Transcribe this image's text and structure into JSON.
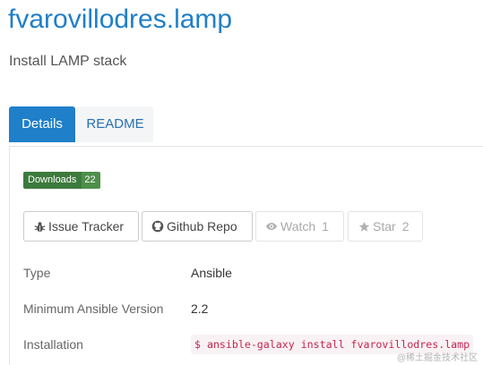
{
  "header": {
    "title": "fvarovillodres.lamp",
    "subtitle": "Install LAMP stack"
  },
  "tabs": [
    {
      "label": "Details",
      "active": true
    },
    {
      "label": "README",
      "active": false
    }
  ],
  "downloads": {
    "label": "Downloads",
    "count": "22",
    "colors": {
      "label_bg": "#3d7a3d",
      "count_bg": "#4e8f4b"
    }
  },
  "buttons": {
    "issue_tracker": {
      "label": "Issue Tracker",
      "icon": "bug-icon"
    },
    "github_repo": {
      "label": "Github Repo",
      "icon": "github-icon"
    },
    "watch": {
      "label": "Watch",
      "count": "1",
      "icon": "eye-icon",
      "disabled": true
    },
    "star": {
      "label": "Star",
      "count": "2",
      "icon": "star-icon",
      "disabled": true
    }
  },
  "info": {
    "type": {
      "label": "Type",
      "value": "Ansible"
    },
    "min_version": {
      "label": "Minimum Ansible Version",
      "value": "2.2"
    },
    "installation": {
      "label": "Installation",
      "command": "$ ansible-galaxy install fvarovillodres.lamp"
    }
  },
  "watermark": "@稀土掘金技术社区",
  "colors": {
    "accent": "#1f7fc9",
    "code_text": "#c7254e",
    "code_bg": "#f9f2f4"
  }
}
